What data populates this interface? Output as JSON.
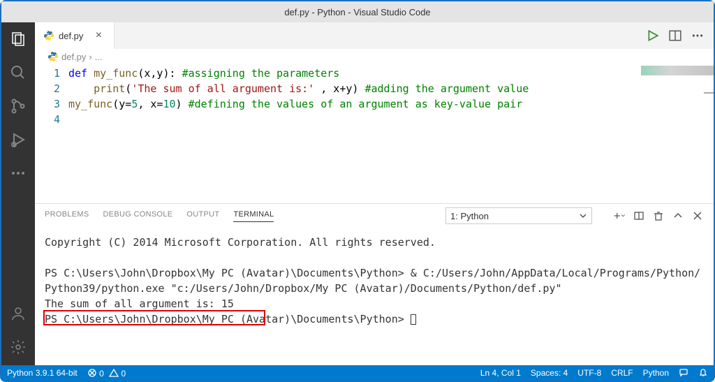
{
  "title": "def.py - Python - Visual Studio Code",
  "tab": {
    "filename": "def.py"
  },
  "breadcrumb": {
    "file": "def.py"
  },
  "tab_actions": {
    "run_title": "Run"
  },
  "code": {
    "line_numbers": [
      "1",
      "2",
      "3",
      "4"
    ],
    "l1_kw": "def",
    "l1_fn": " my_func",
    "l1_params": "(x,y): ",
    "l1_com": "#assigning the parameters",
    "l2_indent": "    ",
    "l2_print": "print",
    "l2_paren1": "(",
    "l2_str": "'The sum of all argument is:'",
    "l2_rest": " , x+y) ",
    "l2_com": "#adding the argument value",
    "l3_call": "my_func",
    "l3_open": "(y=",
    "l3_n1": "5",
    "l3_mid": ", x=",
    "l3_n2": "10",
    "l3_close": ") ",
    "l3_com": "#defining the values of an argument as key-value pair"
  },
  "panel": {
    "tabs": {
      "problems": "Problems",
      "debug": "Debug Console",
      "output": "Output",
      "terminal": "Terminal"
    },
    "select": "1: Python"
  },
  "terminal": {
    "copyright": "Copyright (C) 2014 Microsoft Corporation. All rights reserved.",
    "ps1_path": "PS C:\\Users\\John\\Dropbox\\My PC (Avatar)\\Documents\\Python> ",
    "cmd": "& C:/Users/John/AppData/Local/Programs/Python/Python39/python.exe \"c:/Users/John/Dropbox/My PC (Avatar)/Documents/Python/def.py\"",
    "output": "The sum of all argument is: 15",
    "ps2": "PS C:\\Users\\John\\Dropbox\\My PC (Avatar)\\Documents\\Python> "
  },
  "status": {
    "python": "Python 3.9.1 64-bit",
    "err": "0",
    "warn": "0",
    "ln": "Ln 4, Col 1",
    "spaces": "Spaces: 4",
    "enc": "UTF-8",
    "eol": "CRLF",
    "lang": "Python"
  }
}
